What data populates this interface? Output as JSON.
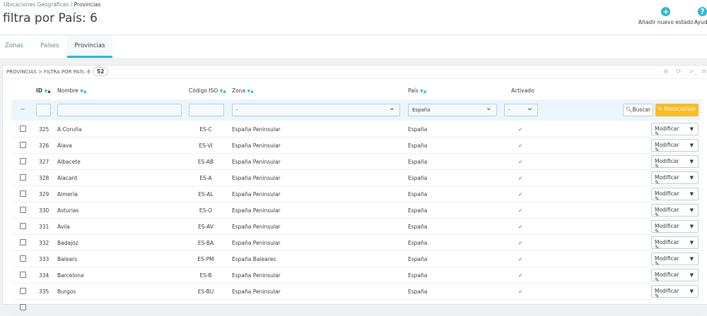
{
  "breadcrumb": {
    "parent": "Ubicaciones Geográficas",
    "sep": "/",
    "current": "Provincias"
  },
  "title": "filtra por País: 6",
  "toolbar": {
    "add": "Añadir nuevo estado",
    "help": "Ayuda"
  },
  "tabs": [
    "Zonas",
    "Países",
    "Provincias"
  ],
  "panel": {
    "heading": "PROVINCIAS > FILTRA POR PAÍS: 6",
    "count": "52"
  },
  "columns": {
    "id": "ID",
    "name": "Nombre",
    "iso": "Código ISO",
    "zone": "Zona",
    "country": "País",
    "active": "Activado"
  },
  "filters": {
    "bulk": "--",
    "zone": "-",
    "country": "España",
    "active": "-",
    "search": "Buscar",
    "reset": "Reinicializar"
  },
  "row_action": "Modificar",
  "rows": [
    {
      "id": "325",
      "name": "A Coruña",
      "iso": "ES-C",
      "zone": "España Peninsular",
      "country": "España",
      "active": "✔"
    },
    {
      "id": "326",
      "name": "Álava",
      "iso": "ES-VI",
      "zone": "España Peninsular",
      "country": "España",
      "active": "✔"
    },
    {
      "id": "327",
      "name": "Albacete",
      "iso": "ES-AB",
      "zone": "España Peninsular",
      "country": "España",
      "active": "✔"
    },
    {
      "id": "328",
      "name": "Alacant",
      "iso": "ES-A",
      "zone": "España Peninsular",
      "country": "España",
      "active": "✔"
    },
    {
      "id": "329",
      "name": "Almería",
      "iso": "ES-AL",
      "zone": "España Peninsular",
      "country": "España",
      "active": "✔"
    },
    {
      "id": "330",
      "name": "Asturias",
      "iso": "ES-O",
      "zone": "España Peninsular",
      "country": "España",
      "active": "✔"
    },
    {
      "id": "331",
      "name": "Ávila",
      "iso": "ES-AV",
      "zone": "España Peninsular",
      "country": "España",
      "active": "✔"
    },
    {
      "id": "332",
      "name": "Badajoz",
      "iso": "ES-BA",
      "zone": "España Peninsular",
      "country": "España",
      "active": "✔"
    },
    {
      "id": "333",
      "name": "Balears",
      "iso": "ES-PM",
      "zone": "España Baleares",
      "country": "España",
      "active": "✔"
    },
    {
      "id": "334",
      "name": "Barcelona",
      "iso": "ES-B",
      "zone": "España Peninsular",
      "country": "España",
      "active": "✔"
    },
    {
      "id": "335",
      "name": "Burgos",
      "iso": "ES-BU",
      "zone": "España Peninsular",
      "country": "España",
      "active": "✔"
    }
  ]
}
